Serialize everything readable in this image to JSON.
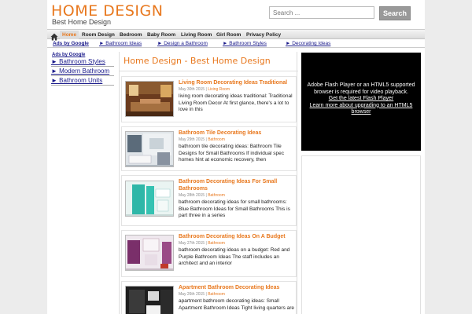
{
  "site": {
    "title": "HOME DESIGN",
    "description": "Best Home Design"
  },
  "search": {
    "placeholder": "Search ...",
    "button_label": "Search"
  },
  "nav": {
    "items": [
      {
        "label": "Home"
      },
      {
        "label": "Room Design"
      },
      {
        "label": "Bedroom"
      },
      {
        "label": "Baby Room"
      },
      {
        "label": "Living Room"
      },
      {
        "label": "Girl Room"
      },
      {
        "label": "Privacy Policy"
      }
    ]
  },
  "subnav": {
    "ads_label": "Ads by Google",
    "links": [
      {
        "label": "► Bathroom Ideas"
      },
      {
        "label": "► Design a Bathroom"
      },
      {
        "label": "► Bathroom Styles"
      },
      {
        "label": "► Decorating Ideas"
      }
    ]
  },
  "left_ads": {
    "ads_label": "Ads by Google",
    "links": [
      {
        "label": "► Bathroom Styles"
      },
      {
        "label": "► Modern Bathroom"
      },
      {
        "label": "► Bathroom Units"
      }
    ]
  },
  "main": {
    "title": "Home Design - Best Home Design",
    "posts": [
      {
        "title": "Living Room Decorating Ideas Traditional",
        "date": "May 30th 2015",
        "separator": "|",
        "category": "Living Room",
        "excerpt": "living room decorating ideas traditional: Traditional Living Room Decor At first glance, there's a lot to love in this"
      },
      {
        "title": "Bathroom Tile Decorating Ideas",
        "date": "May 29th 2015",
        "separator": "|",
        "category": "Bathroom",
        "excerpt": "bathroom tile decorating ideas: Bathroom Tile Designs for Small Bathrooms If individual spec homes hint at economic recovery, then"
      },
      {
        "title": "Bathroom Decorating Ideas For Small Bathrooms",
        "date": "May 28th 2015",
        "separator": "|",
        "category": "Bathroom",
        "excerpt": "bathroom decorating ideas for small bathrooms: Blue Bathroom Ideas for Small Bathrooms This is part three in a series"
      },
      {
        "title": "Bathroom Decorating Ideas On A Budget",
        "date": "May 27th 2015",
        "separator": "|",
        "category": "Bathroom",
        "excerpt": "bathroom decorating ideas on a budget: Red and Purple Bathroom Ideas The staff includes an architect and an interior"
      },
      {
        "title": "Apartment Bathroom Decorating Ideas",
        "date": "May 26th 2015",
        "separator": "|",
        "category": "Bathroom",
        "excerpt": "apartment bathroom decorating ideas: Small Apartment Bathroom Ideas Tight living quarters are"
      }
    ]
  },
  "flash": {
    "line1": "Adobe Flash Player or an HTML5 supported",
    "line2": "browser is required for video playback.",
    "link1": "Get the latest Flash Player",
    "link2": "Learn more about upgrading to an HTML5",
    "link2b": "browser"
  },
  "colors": {
    "accent": "#e8781e",
    "link": "#1a1a8a"
  }
}
